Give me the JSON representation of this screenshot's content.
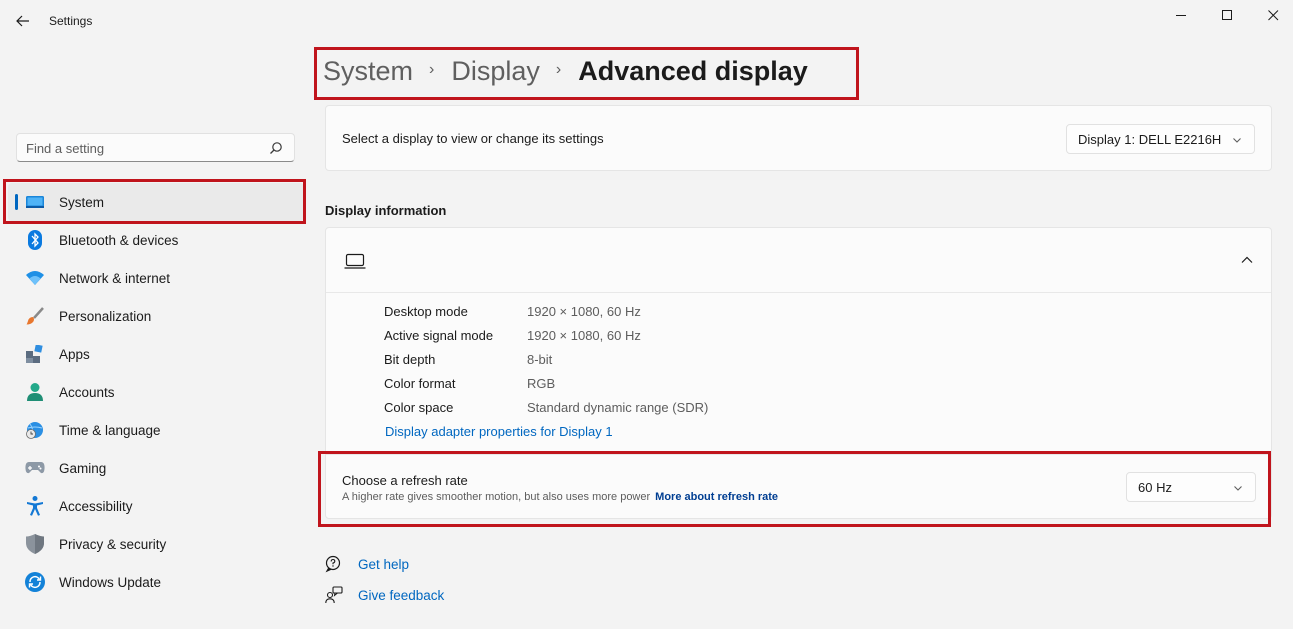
{
  "window": {
    "app_title": "Settings"
  },
  "search": {
    "placeholder": "Find a setting"
  },
  "sidebar": {
    "items": [
      {
        "label": "System",
        "active": true
      },
      {
        "label": "Bluetooth & devices"
      },
      {
        "label": "Network & internet"
      },
      {
        "label": "Personalization"
      },
      {
        "label": "Apps"
      },
      {
        "label": "Accounts"
      },
      {
        "label": "Time & language"
      },
      {
        "label": "Gaming"
      },
      {
        "label": "Accessibility"
      },
      {
        "label": "Privacy & security"
      },
      {
        "label": "Windows Update"
      }
    ]
  },
  "breadcrumb": {
    "items": [
      "System",
      "Display"
    ],
    "current": "Advanced display"
  },
  "display_select": {
    "label": "Select a display to view or change its settings",
    "value": "Display 1: DELL E2216H"
  },
  "display_info": {
    "section_title": "Display information",
    "rows": [
      {
        "key": "Desktop mode",
        "value": "1920 × 1080, 60 Hz"
      },
      {
        "key": "Active signal mode",
        "value": "1920 × 1080, 60 Hz"
      },
      {
        "key": "Bit depth",
        "value": "8-bit"
      },
      {
        "key": "Color format",
        "value": "RGB"
      },
      {
        "key": "Color space",
        "value": "Standard dynamic range (SDR)"
      }
    ],
    "adapter_link": "Display adapter properties for Display 1"
  },
  "refresh_rate": {
    "title": "Choose a refresh rate",
    "description": "A higher rate gives smoother motion, but also uses more power",
    "more_link": "More about refresh rate",
    "value": "60 Hz"
  },
  "help": {
    "get_help": "Get help",
    "give_feedback": "Give feedback"
  },
  "colors": {
    "accent": "#0067c0",
    "highlight_box": "#c0141c",
    "background": "#f3f3f3"
  }
}
